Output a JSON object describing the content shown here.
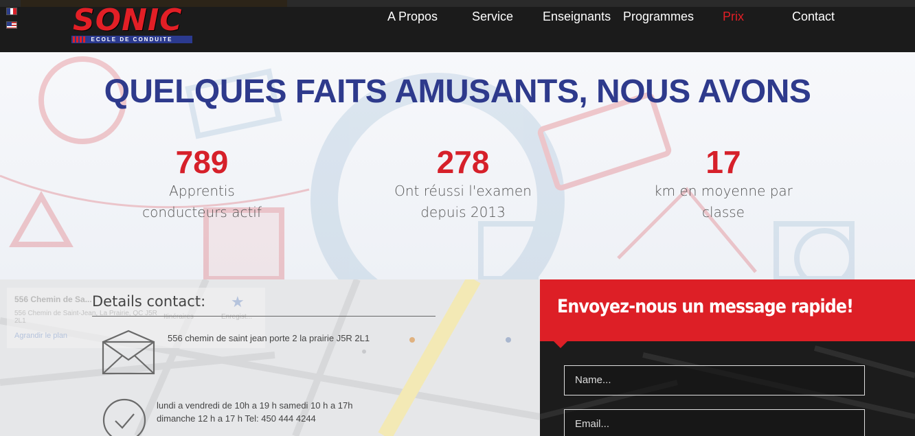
{
  "header": {
    "logo_text": "SONIC",
    "logo_subtitle": "ECOLE DE CONDUITE",
    "nav": [
      {
        "label": "A Propos"
      },
      {
        "label": "Service"
      },
      {
        "label": "Enseignants"
      },
      {
        "label": "Programmes"
      },
      {
        "label": "Prix",
        "active": true
      },
      {
        "label": "Contact"
      }
    ],
    "colors": {
      "brand_red": "#e21f26",
      "brand_blue": "#2b3a8f"
    }
  },
  "facts": {
    "title": "QUELQUES FAITS AMUSANTS, NOUS AVONS",
    "items": [
      {
        "number": "789",
        "label_line1": "Apprentis",
        "label_line2": "conducteurs actif"
      },
      {
        "number": "278",
        "label_line1": "Ont réussi l'examen",
        "label_line2": "depuis 2013"
      },
      {
        "number": "17",
        "label_line1": "km en moyenne par",
        "label_line2": "classe"
      }
    ]
  },
  "contact": {
    "title": "Details contact:",
    "address": "556 chemin de saint jean porte 2 la prairie J5R 2L1",
    "hours": "lundi a vendredi de 10h a 19 h samedi 10 h a 17h dimanche 12 h a 17 h Tel: 450 444 4244",
    "map_card": {
      "name": "556 Chemin de Sa...",
      "address": "556 Chemin de Saint-Jean, La Prairie, QC J5R 2L1",
      "link": "Agrandir le plan",
      "itineraries": "Itinéraires",
      "save": "Enregist..."
    }
  },
  "message": {
    "title": "Envoyez-nous un message rapide!",
    "name_placeholder": "Name...",
    "email_placeholder": "Email..."
  }
}
